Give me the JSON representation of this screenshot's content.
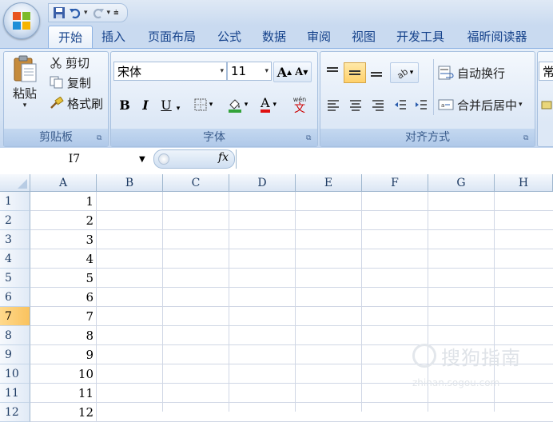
{
  "tabs": [
    "开始",
    "插入",
    "页面布局",
    "公式",
    "数据",
    "审阅",
    "视图",
    "开发工具",
    "福昕阅读器"
  ],
  "clipboard": {
    "paste": "粘贴",
    "cut": "剪切",
    "copy": "复制",
    "format_painter": "格式刷",
    "label": "剪贴板"
  },
  "font": {
    "name": "宋体",
    "size": "11",
    "label": "字体",
    "bold": "B",
    "italic": "I",
    "underline": "U",
    "increase": "A",
    "decrease": "A",
    "font_color": "A",
    "phonetic": "wén"
  },
  "alignment": {
    "wrap": "自动换行",
    "merge": "合并后居中",
    "label": "对齐方式"
  },
  "number": {
    "format_partial": "常"
  },
  "formula_bar": {
    "name_box": "I7",
    "fx": "fx"
  },
  "columns": [
    "A",
    "B",
    "C",
    "D",
    "E",
    "F",
    "G",
    "H"
  ],
  "rows": [
    {
      "num": "1",
      "a": "1"
    },
    {
      "num": "2",
      "a": "2"
    },
    {
      "num": "3",
      "a": "3"
    },
    {
      "num": "4",
      "a": "4"
    },
    {
      "num": "5",
      "a": "5"
    },
    {
      "num": "6",
      "a": "6"
    },
    {
      "num": "7",
      "a": "7"
    },
    {
      "num": "8",
      "a": "8"
    },
    {
      "num": "9",
      "a": "9"
    },
    {
      "num": "10",
      "a": "10"
    },
    {
      "num": "11",
      "a": "11"
    },
    {
      "num": "12",
      "a": "12"
    }
  ],
  "active_row": "7",
  "watermark": {
    "main": "搜狗指南",
    "sub": "zhinan.sogou.com"
  }
}
